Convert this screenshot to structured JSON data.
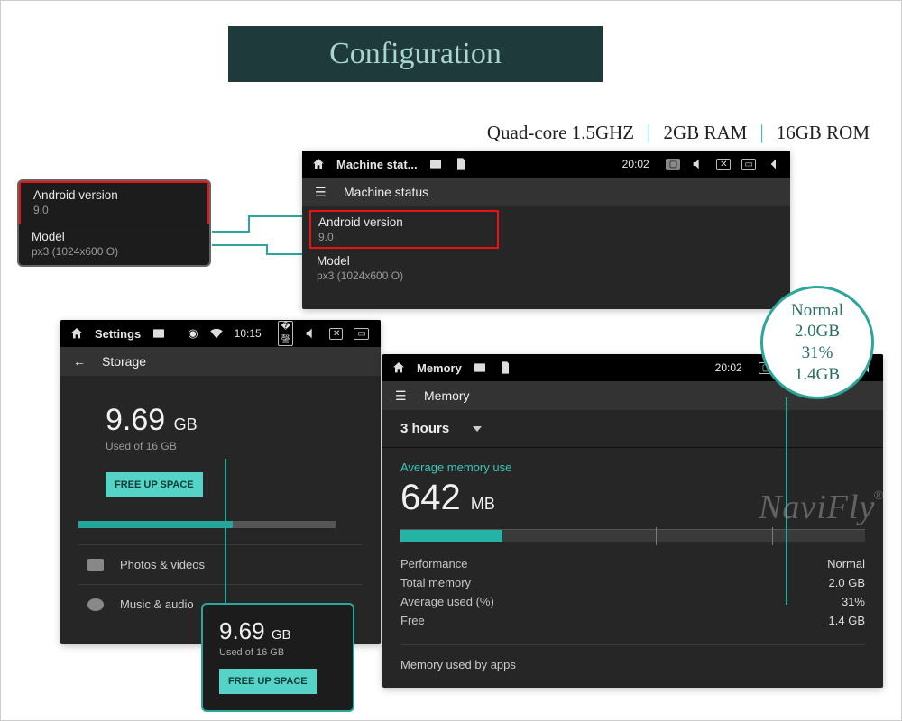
{
  "header": {
    "title": "Configuration"
  },
  "specs": {
    "cpu": "Quad-core  1.5GHZ",
    "ram": "2GB RAM",
    "rom": "16GB ROM"
  },
  "android_callout": {
    "version_label": "Android version",
    "version_value": "9.0",
    "model_label": "Model",
    "model_value": "px3 (1024x600 O)"
  },
  "machine_status_window": {
    "top_title": "Machine stat...",
    "time": "20:02",
    "sub_title": "Machine status",
    "version_label": "Android version",
    "version_value": "9.0",
    "model_label": "Model",
    "model_value": "px3 (1024x600 O)"
  },
  "storage_window": {
    "top_title": "Settings",
    "time": "10:15",
    "sub_title": "Storage",
    "used_value": "9.69",
    "used_unit": "GB",
    "used_caption": "Used of 16 GB",
    "free_up": "FREE UP SPACE",
    "item_photos": "Photos & videos",
    "item_music": "Music & audio"
  },
  "storage_callout": {
    "value": "9.69",
    "unit": "GB",
    "caption": "Used of 16 GB",
    "button": "FREE UP SPACE"
  },
  "memory_window": {
    "top_title": "Memory",
    "time": "20:02",
    "sub_title": "Memory",
    "hours": "3 hours",
    "avg_label": "Average memory use",
    "avg_value": "642",
    "avg_unit": "MB",
    "stats": {
      "perf_label": "Performance",
      "perf_value": "Normal",
      "total_label": "Total memory",
      "total_value": "2.0 GB",
      "avg_label": "Average used (%)",
      "avg_value": "31%",
      "free_label": "Free",
      "free_value": "1.4 GB"
    },
    "apps_label": "Memory used by apps"
  },
  "memory_circle": {
    "line1": "Normal",
    "line2": "2.0GB",
    "line3": "31%",
    "line4": "1.4GB"
  },
  "watermark": "NaviFly"
}
